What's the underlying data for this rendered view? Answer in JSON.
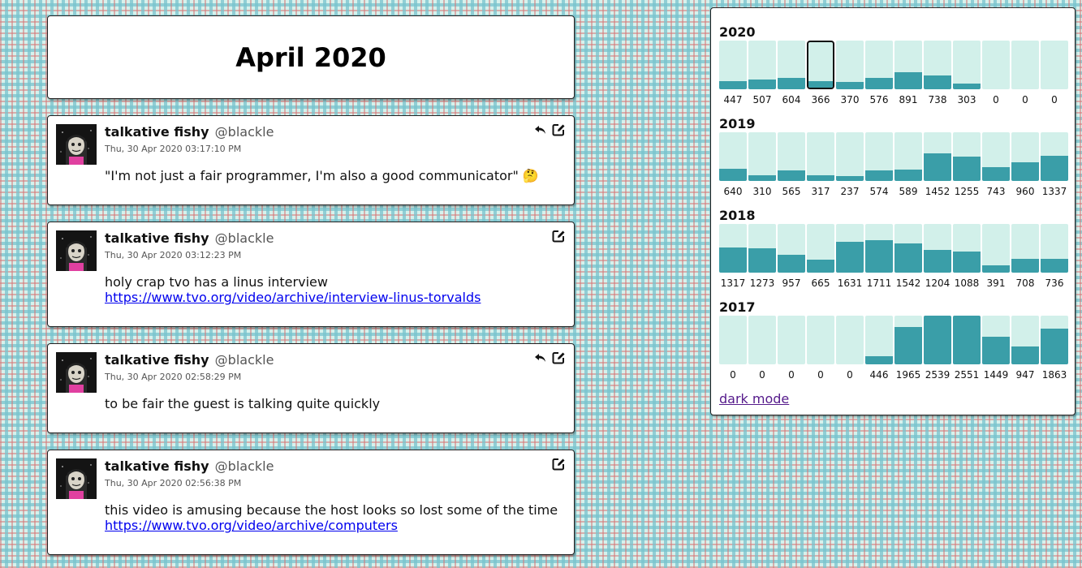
{
  "page_title": "April 2020",
  "posts": [
    {
      "name": "talkative fishy",
      "handle": "@blackle",
      "date": "Thu, 30 Apr 2020 03:17:10 PM",
      "text": "\"I'm not just a fair programmer, I'm also a good communicator\" 🤔",
      "link": "",
      "actions": [
        "reply-icon",
        "edit-icon"
      ]
    },
    {
      "name": "talkative fishy",
      "handle": "@blackle",
      "date": "Thu, 30 Apr 2020 03:12:23 PM",
      "text": "holy crap tvo has a linus interview",
      "link": "https://www.tvo.org/video/archive/interview-linus-torvalds",
      "actions": [
        "edit-icon"
      ]
    },
    {
      "name": "talkative fishy",
      "handle": "@blackle",
      "date": "Thu, 30 Apr 2020 02:58:29 PM",
      "text": "to be fair the guest is talking quite quickly",
      "link": "",
      "actions": [
        "reply-icon",
        "edit-icon"
      ]
    },
    {
      "name": "talkative fishy",
      "handle": "@blackle",
      "date": "Thu, 30 Apr 2020 02:56:38 PM",
      "text": "this video is amusing because the host looks so lost some of the time",
      "link": "https://www.tvo.org/video/archive/computers",
      "actions": [
        "edit-icon"
      ]
    }
  ],
  "archive": {
    "years": [
      {
        "year": "2020",
        "counts": [
          447,
          507,
          604,
          366,
          370,
          576,
          891,
          738,
          303,
          0,
          0,
          0
        ],
        "current_month_index": 3
      },
      {
        "year": "2019",
        "counts": [
          640,
          310,
          565,
          317,
          237,
          574,
          589,
          1452,
          1255,
          743,
          960,
          1337
        ]
      },
      {
        "year": "2018",
        "counts": [
          1317,
          1273,
          957,
          665,
          1631,
          1711,
          1542,
          1204,
          1088,
          391,
          708,
          736
        ]
      },
      {
        "year": "2017",
        "counts": [
          0,
          0,
          0,
          0,
          0,
          446,
          1965,
          2539,
          2551,
          1449,
          947,
          1863
        ]
      }
    ],
    "max_count": 2551,
    "dark_mode_label": "dark mode"
  },
  "colors": {
    "bar_fill": "#3a9ea8",
    "bar_track": "#d2f0ea",
    "link": "#0000ee",
    "visited_link": "#551a8b"
  }
}
